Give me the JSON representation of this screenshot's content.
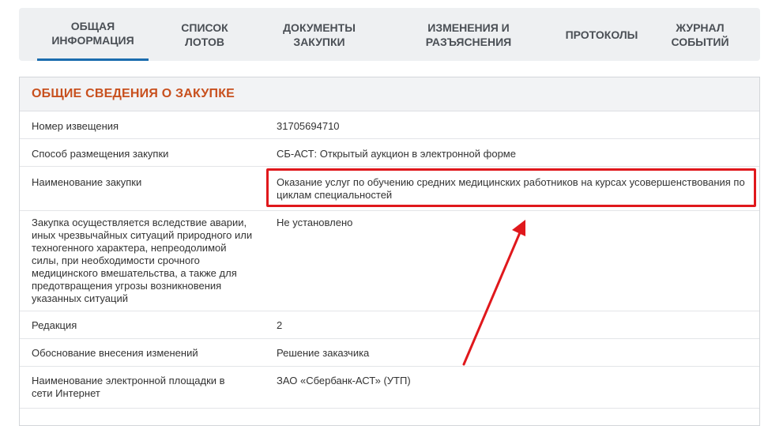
{
  "tabs": [
    {
      "line1": "ОБЩАЯ",
      "line2": "ИНФОРМАЦИЯ",
      "active": true
    },
    {
      "line1": "СПИСОК",
      "line2": "ЛОТОВ"
    },
    {
      "line1": "ДОКУМЕНТЫ",
      "line2": "ЗАКУПКИ"
    },
    {
      "line1": "ИЗМЕНЕНИЯ И",
      "line2": "РАЗЪЯСНЕНИЯ"
    },
    {
      "line1": "ПРОТОКОЛЫ",
      "line2": ""
    },
    {
      "line1": "ЖУРНАЛ",
      "line2": "СОБЫТИЙ"
    }
  ],
  "panel": {
    "title": "ОБЩИЕ СВЕДЕНИЯ О ЗАКУПКЕ",
    "rows": [
      {
        "label": "Номер извещения",
        "value": "31705694710"
      },
      {
        "label": "Способ размещения закупки",
        "value": "СБ-АСТ: Открытый аукцион в электронной форме"
      },
      {
        "label": "Наименование закупки",
        "value": "Оказание услуг по обучению средних медицинских работников на курсах усовершенствования по циклам специальностей"
      },
      {
        "label": "Закупка осуществляется вследствие аварии, иных чрезвычайных ситуаций природного или техногенного характера, непреодолимой силы, при необходимости срочного медицинского вмешательства, а также для предотвращения угрозы возникновения указанных ситуаций",
        "value": "Не установлено"
      },
      {
        "label": "Редакция",
        "value": "2"
      },
      {
        "label": "Обоснование внесения изменений",
        "value": "Решение заказчика"
      },
      {
        "label": "Наименование электронной площадки в сети Интернет",
        "value": "ЗАО «Сбербанк-АСТ» (УТП)"
      }
    ]
  },
  "annotation": {
    "color": "#e0181c"
  }
}
